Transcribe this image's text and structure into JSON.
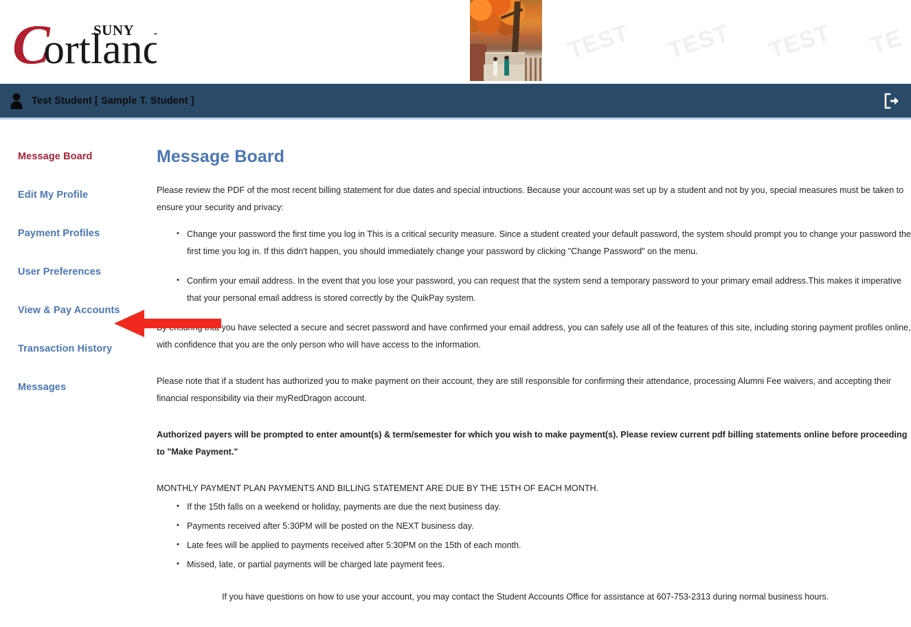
{
  "brand": {
    "logo_primary": "ortland",
    "logo_suny": "SUNY",
    "logo_initial": "C",
    "accent_red": "#a32638",
    "accent_blue": "#4a77b4",
    "navbar_navy": "#294b68"
  },
  "banner": {
    "photo_alt": "campus-autumn-photo",
    "watermark_text": "TEST",
    "watermarks": [
      "TEST",
      "TEST",
      "TEST",
      "TE"
    ]
  },
  "userbar": {
    "user_display": "Test Student [ Sample T. Student ]",
    "user_icon": "person-icon",
    "logout_icon": "logout-icon"
  },
  "sidebar": {
    "items": [
      {
        "label": "Message Board",
        "active": true
      },
      {
        "label": "Edit My Profile",
        "active": false
      },
      {
        "label": "Payment Profiles",
        "active": false
      },
      {
        "label": "User Preferences",
        "active": false
      },
      {
        "label": "View & Pay Accounts",
        "active": false
      },
      {
        "label": "Transaction History",
        "active": false
      },
      {
        "label": "Messages",
        "active": false
      }
    ]
  },
  "main": {
    "title": "Message Board",
    "intro": "Please review the PDF of the most recent billing statement for due dates and special intructions. Because your account was set up by a student and not by you, special measures must be taken to ensure your security and privacy:",
    "security_bullets": [
      "Change your password the first time you log in This is a critical security measure. Since a student created your default password, the system should prompt you to change your password the first time you log in. If this didn't happen, you should immediately change your password by clicking \"Change Password\" on the menu.",
      "Confirm your email address. In the event that you lose your password, you can request that the system send a temporary password to your primary email address.This makes it imperative that your personal email address is stored correctly by the QuikPay system."
    ],
    "assurance": "By ensuring that you have selected a secure and secret password and have confirmed your email address, you can safely use all of the features of this site, including storing payment profiles online, with confidence that you are the only person who will have access to the information.",
    "student_note": "Please note that if a student has authorized you to make payment on their account, they are still responsible for confirming their attendance, processing Alumni Fee waivers, and accepting their financial responsibility via their myRedDragon account.",
    "authorized_payers": "Authorized payers will be prompted to enter amount(s) & term/semester for which you wish to make payment(s). Please review current pdf billing statements online before proceeding to \"Make Payment.\"",
    "monthly_heading": "MONTHLY PAYMENT PLAN PAYMENTS AND BILLING STATEMENT ARE DUE BY THE 15TH OF EACH MONTH.",
    "monthly_bullets": [
      "If the 15th falls on a weekend or holiday, payments are due the next business day.",
      "Payments received after 5:30PM will be posted on the NEXT business day.",
      "Late fees will be applied to payments received after 5:30PM on the 15th of each month.",
      "Missed, late, or partial payments will be charged late payment fees."
    ],
    "contact_note": "If you have questions on how to use your account, you may contact the Student Accounts Office for assistance at 607-753-2313 during normal business hours."
  },
  "annotation": {
    "arrow_color": "#f0281e",
    "arrow_name": "red-arrow-pointing-to-view-and-pay-accounts"
  }
}
